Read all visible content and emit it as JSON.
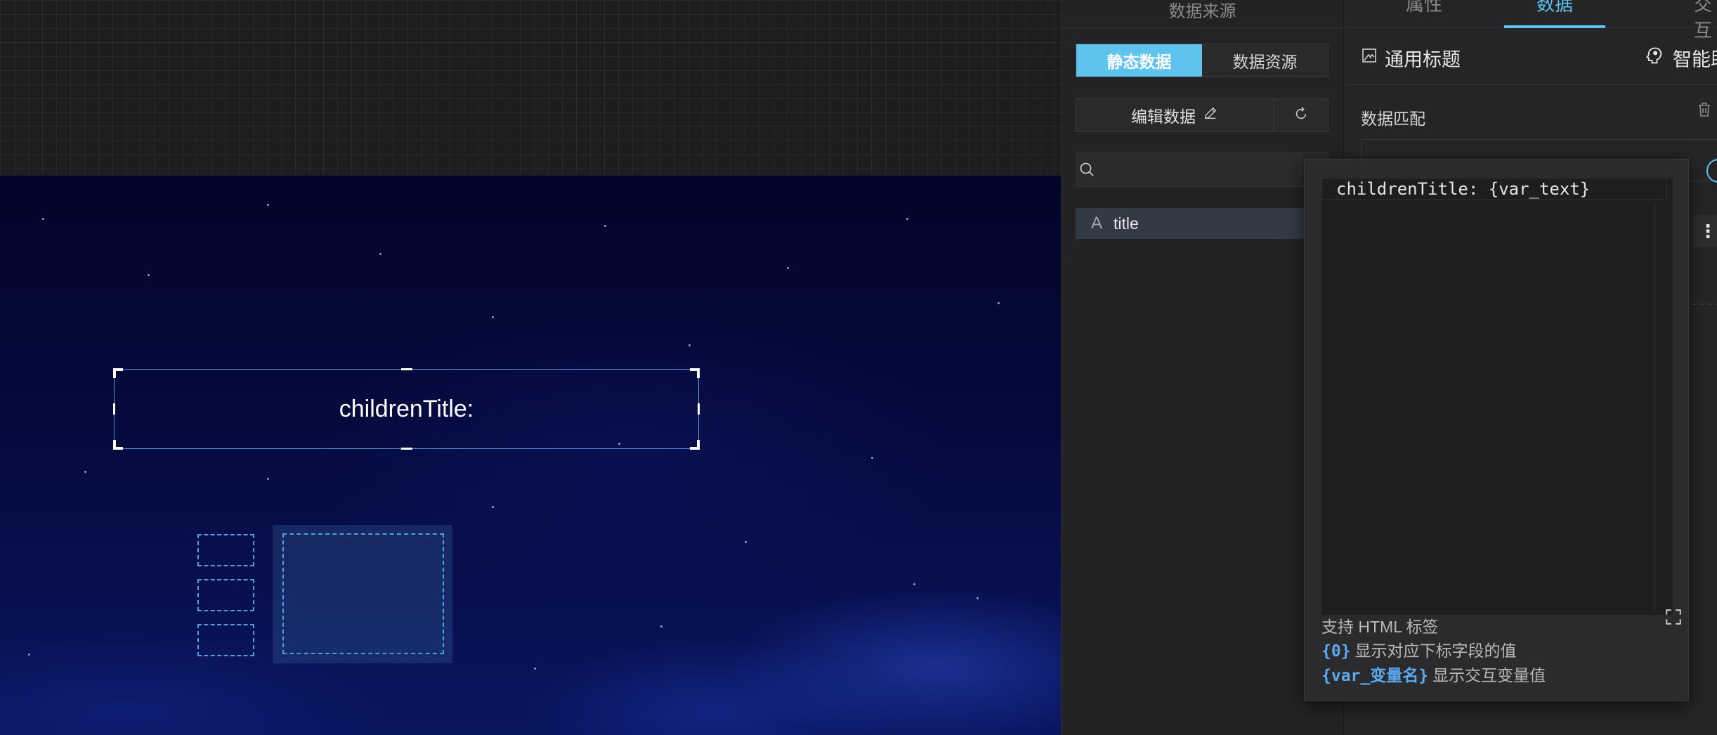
{
  "canvas": {
    "title_text": "childrenTitle:"
  },
  "data_source_panel": {
    "header": "数据来源",
    "tabs": [
      {
        "label": "静态数据",
        "active": true
      },
      {
        "label": "数据资源",
        "active": false
      }
    ],
    "edit_data_label": "编辑数据",
    "search": {
      "value": "",
      "placeholder": ""
    },
    "fields": [
      {
        "type_icon": "A",
        "name": "title"
      }
    ]
  },
  "config_panel": {
    "tabs": [
      {
        "label": "属性",
        "active": false
      },
      {
        "label": "数据",
        "active": true
      },
      {
        "label": "交互",
        "active": false
      }
    ],
    "component_name": "通用标题",
    "ai_label": "智能助手",
    "data_match_label": "数据匹配"
  },
  "popup": {
    "code_value": "childrenTitle: {var_text}",
    "hints": [
      {
        "code": "",
        "text": "支持 HTML 标签"
      },
      {
        "code": "{0}",
        "text": "显示对应下标字段的值"
      },
      {
        "code": "{var_变量名}",
        "text": "显示交互变量值"
      }
    ]
  },
  "colors": {
    "accent": "#5fc3f0",
    "panel_bg": "#232325",
    "selection_border": "#5a8ed6",
    "placeholder_dash": "#4fa0d6"
  }
}
